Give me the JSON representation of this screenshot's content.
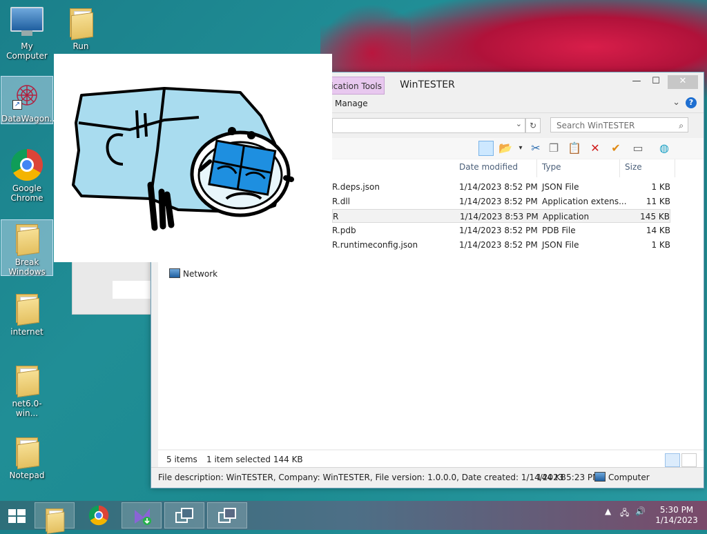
{
  "desktop": {
    "icons": [
      {
        "label": "My Computer"
      },
      {
        "label": "Run"
      },
      {
        "label": "DataWagon..."
      },
      {
        "label": "Google Chrome"
      },
      {
        "label": "Break Windows"
      },
      {
        "label": "internet"
      },
      {
        "label": "net6.0-win..."
      },
      {
        "label": "Notepad"
      }
    ]
  },
  "explorer": {
    "title": "WinTESTER",
    "context_tab": "lication Tools",
    "ribbon_tab": "Manage",
    "search_placeholder": "Search WinTESTER",
    "columns": {
      "date": "Date modified",
      "type": "Type",
      "size": "Size"
    },
    "files": [
      {
        "name": "R.deps.json",
        "date": "1/14/2023 8:52 PM",
        "type": "JSON File",
        "size": "1 KB"
      },
      {
        "name": "R.dll",
        "date": "1/14/2023 8:52 PM",
        "type": "Application extens...",
        "size": "11 KB"
      },
      {
        "name": "R",
        "date": "1/14/2023 8:53 PM",
        "type": "Application",
        "size": "145 KB",
        "selected": true
      },
      {
        "name": "R.pdb",
        "date": "1/14/2023 8:52 PM",
        "type": "PDB File",
        "size": "14 KB"
      },
      {
        "name": "R.runtimeconfig.json",
        "date": "1/14/2023 8:52 PM",
        "type": "JSON File",
        "size": "1 KB"
      }
    ],
    "nav": {
      "network": "Network"
    },
    "status": {
      "items": "5 items",
      "selected": "1 item selected  144 KB"
    },
    "details": {
      "description": "File description: WinTESTER, Company: WinTESTER, File version: 1.0.0.0, Date created: 1/14/2023 5:23 PM",
      "size": "144 KB",
      "location": "Computer"
    }
  },
  "taskbar": {
    "clock_time": "5:30 PM",
    "clock_date": "1/14/2023"
  },
  "colors": {
    "accent": "#1e6fd1",
    "context_tab": "#e8c8ef"
  }
}
